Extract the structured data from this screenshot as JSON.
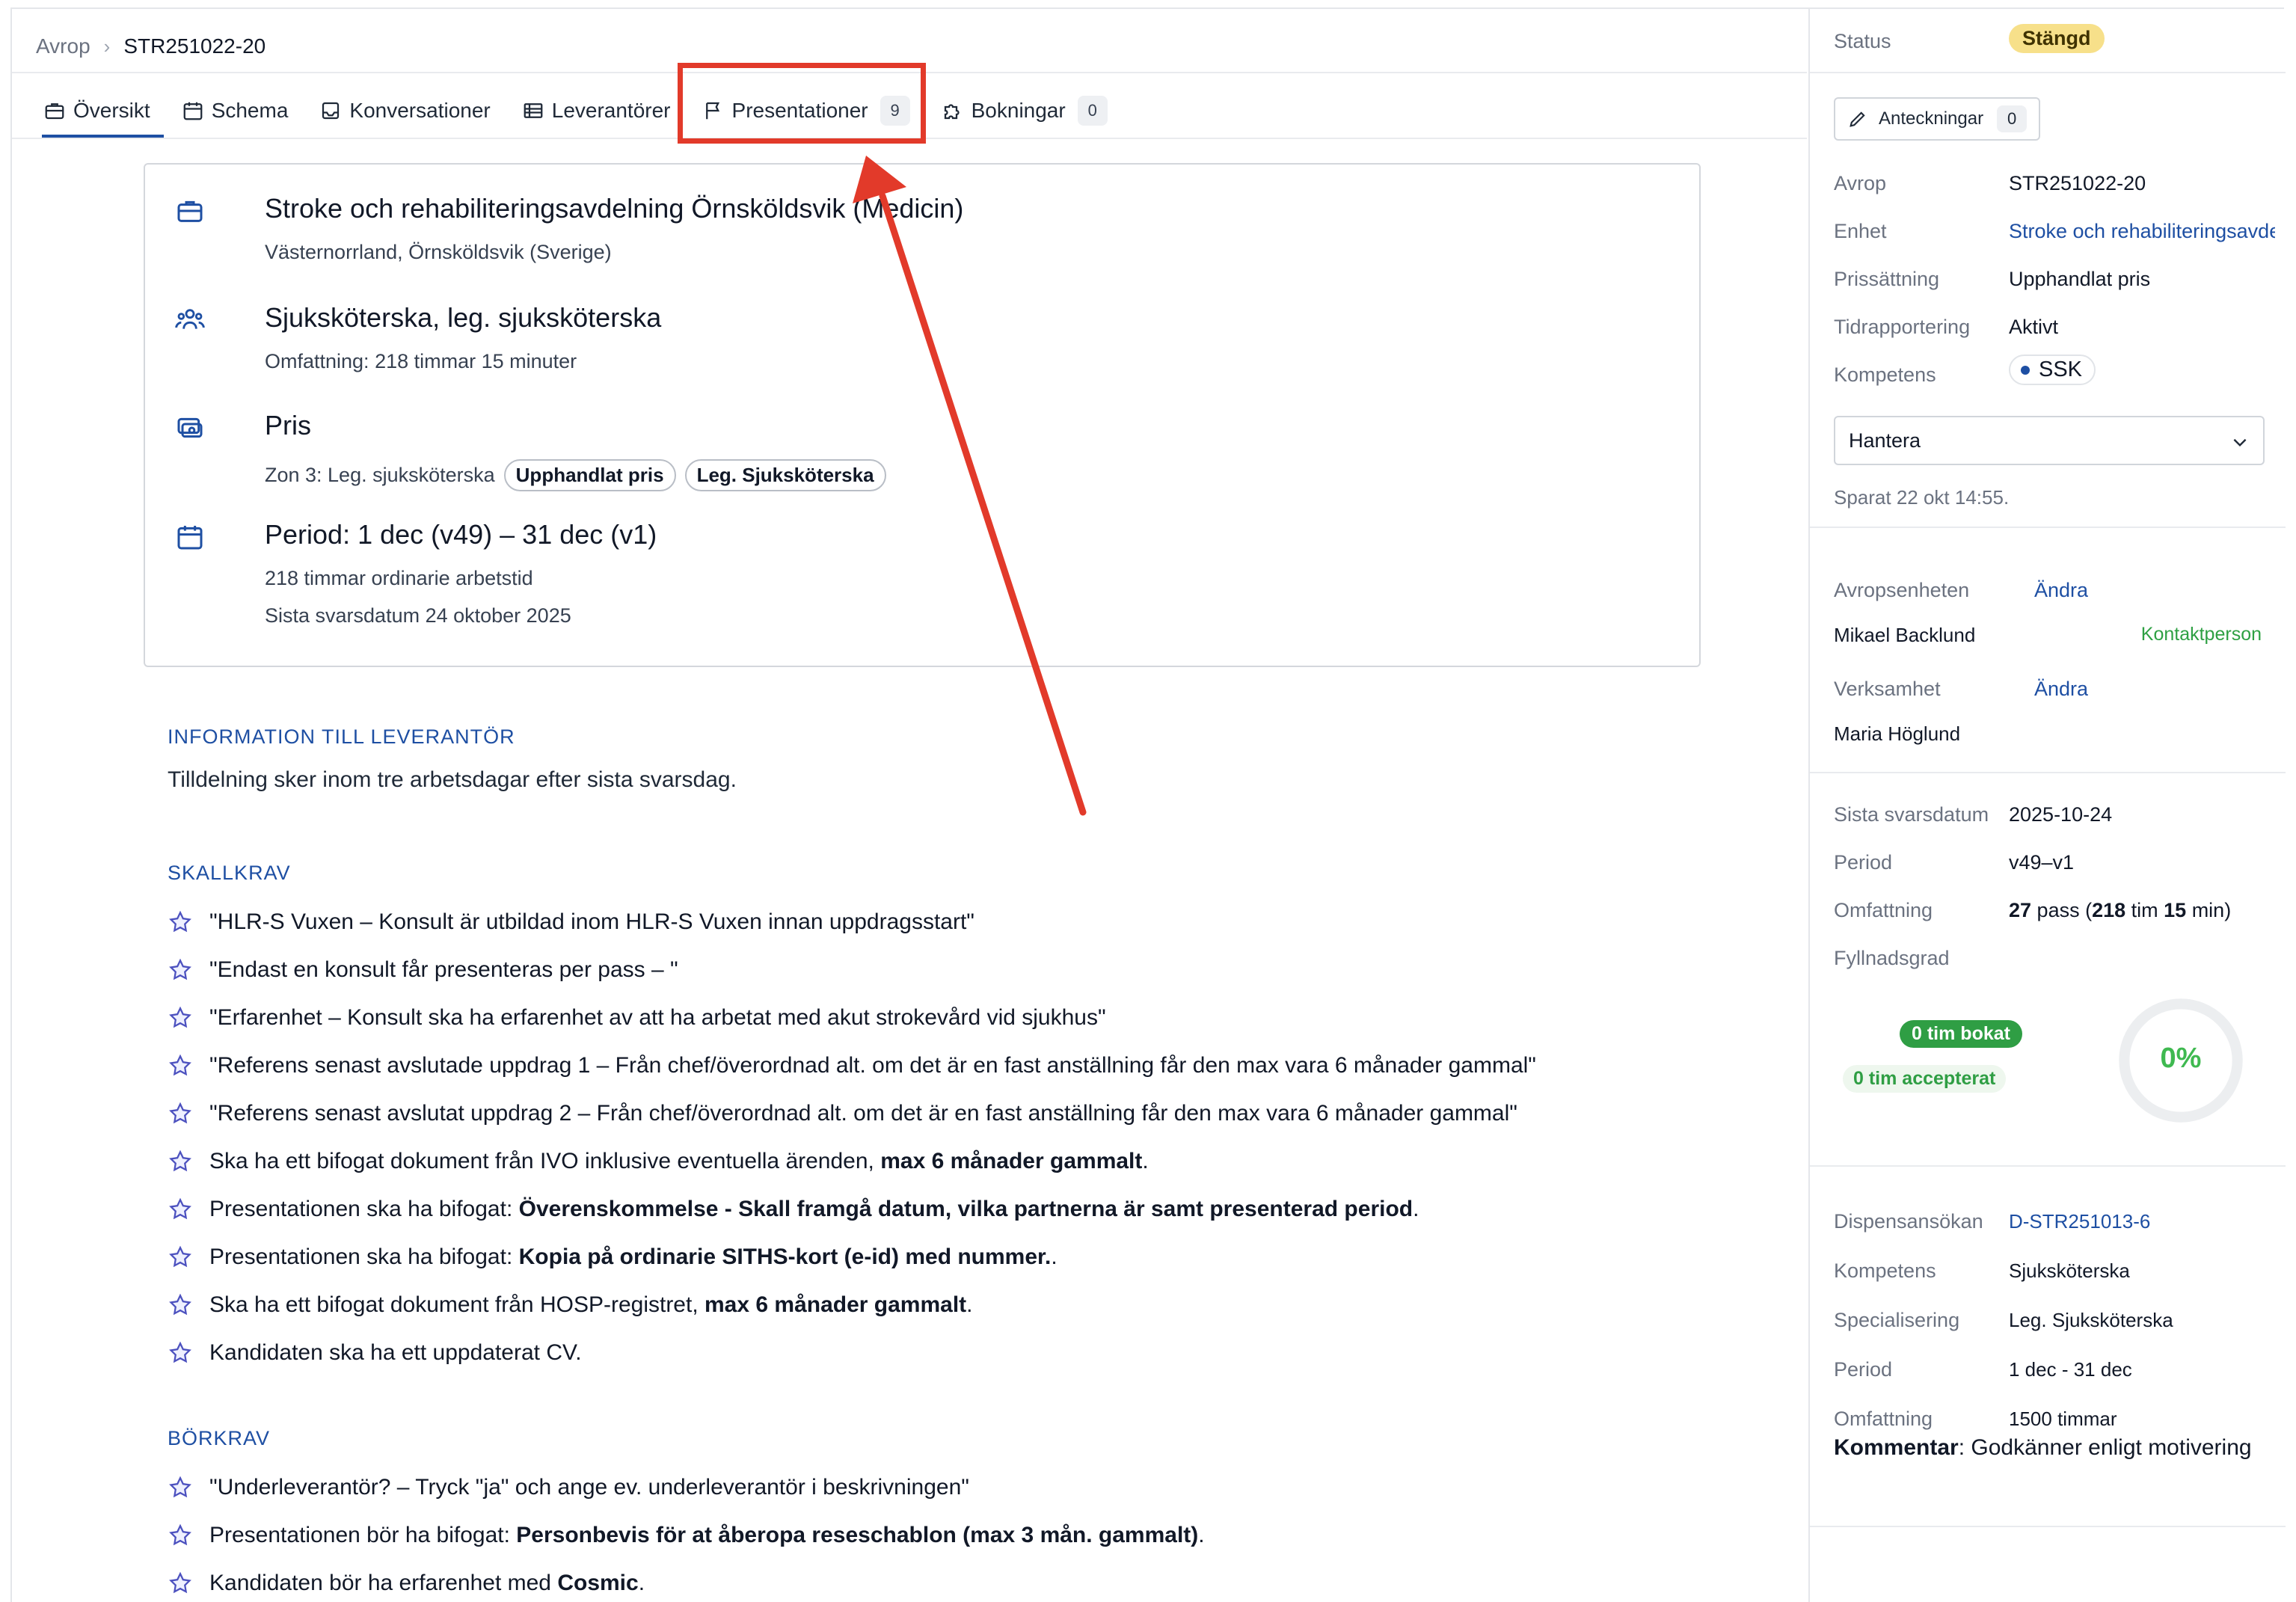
{
  "breadcrumb": {
    "root": "Avrop",
    "current": "STR251022-20"
  },
  "tabs": [
    {
      "label": "Översikt",
      "icon": "briefcase-icon"
    },
    {
      "label": "Schema",
      "icon": "calendar-icon"
    },
    {
      "label": "Konversationer",
      "icon": "inbox-icon"
    },
    {
      "label": "Leverantörer",
      "icon": "list-icon"
    },
    {
      "label": "Presentationer",
      "icon": "flag-icon",
      "badge": "9"
    },
    {
      "label": "Bokningar",
      "icon": "puzzle-icon",
      "badge": "0"
    }
  ],
  "card": {
    "unit_title": "Stroke och rehabiliteringsavdelning Örnsköldsvik (Medicin)",
    "unit_location": "Västernorrland, Örnsköldsvik (Sverige)",
    "role_title": "Sjuksköterska, leg. sjuksköterska",
    "role_scope": "Omfattning: 218 timmar 15 minuter",
    "price_title": "Pris",
    "price_zone": "Zon 3: Leg. sjuksköterska",
    "price_tag1": "Upphandlat pris",
    "price_tag2": "Leg. Sjuksköterska",
    "period_title": "Period: 1 dec (v49) – 31 dec (v1)",
    "period_hours": "218 timmar ordinarie arbetstid",
    "period_deadline": "Sista svarsdatum 24 oktober 2025"
  },
  "info": {
    "heading": "INFORMATION TILL LEVERANTÖR",
    "text": "Tilldelning sker inom tre arbetsdagar efter sista svarsdag."
  },
  "skallkrav": {
    "heading": "SKALLKRAV",
    "items": [
      {
        "text": "\"HLR-S Vuxen – Konsult är utbildad inom HLR-S Vuxen innan uppdragsstart\"",
        "bold": "",
        "tail": ""
      },
      {
        "text": "\"Endast en konsult får presenteras per pass – \"",
        "bold": "",
        "tail": ""
      },
      {
        "text": "\"Erfarenhet – Konsult ska ha erfarenhet av att ha arbetat med akut strokevård vid sjukhus\"",
        "bold": "",
        "tail": ""
      },
      {
        "text": "\"Referens senast avslutade uppdrag 1 – Från chef/överordnad alt. om det är en fast anställning får den max vara 6 månader gammal\"",
        "bold": "",
        "tail": ""
      },
      {
        "text": "\"Referens senast avslutat uppdrag 2 – Från chef/överordnad alt. om det är en fast anställning får den max vara 6 månader gammal\"",
        "bold": "",
        "tail": ""
      },
      {
        "text": "Ska ha ett bifogat dokument från IVO inklusive eventuella ärenden, ",
        "bold": "max 6 månader gammalt",
        "tail": "."
      },
      {
        "text": "Presentationen ska ha bifogat: ",
        "bold": "Överenskommelse - Skall framgå datum, vilka partnerna är samt presenterad period",
        "tail": "."
      },
      {
        "text": "Presentationen ska ha bifogat: ",
        "bold": "Kopia på ordinarie SITHS-kort (e-id) med nummer.",
        "tail": "."
      },
      {
        "text": "Ska ha ett bifogat dokument från HOSP-registret, ",
        "bold": "max 6 månader gammalt",
        "tail": "."
      },
      {
        "text": "Kandidaten ska ha ett uppdaterat CV.",
        "bold": "",
        "tail": ""
      }
    ]
  },
  "borkrav": {
    "heading": "BÖRKRAV",
    "items": [
      {
        "text": "\"Underleverantör? – Tryck \"ja\" och ange ev. underleverantör i beskrivningen\"",
        "bold": "",
        "tail": ""
      },
      {
        "text": "Presentationen bör ha bifogat: ",
        "bold": "Personbevis för at åberopa reseschablon (max 3 mån. gammalt)",
        "tail": "."
      },
      {
        "text": "Kandidaten bör ha erfarenhet med ",
        "bold": "Cosmic",
        "tail": "."
      }
    ]
  },
  "sidebar": {
    "status_label": "Status",
    "status_value": "Stängd",
    "notes_label": "Anteckningar",
    "notes_count": "0",
    "details": [
      {
        "label": "Avrop",
        "value": "STR251022-20",
        "link": false
      },
      {
        "label": "Enhet",
        "value": "Stroke och rehabiliteringsavdelning",
        "link": true
      },
      {
        "label": "Prissättning",
        "value": "Upphandlat pris",
        "link": false
      },
      {
        "label": "Tidrapportering",
        "value": "Aktivt",
        "link": false
      }
    ],
    "competence_label": "Kompetens",
    "competence_chip": "SSK",
    "manage_label": "Hantera",
    "saved_text": "Sparat 22 okt 14:55.",
    "contacts": {
      "unit_label": "Avropsenheten",
      "unit_edit": "Ändra",
      "unit_person": "Mikael Backlund",
      "unit_role": "Kontaktperson",
      "business_label": "Verksamhet",
      "business_edit": "Ändra",
      "business_person": "Maria Höglund"
    },
    "schedule": {
      "deadline_label": "Sista svarsdatum",
      "deadline_value": "2025-10-24",
      "period_label": "Period",
      "period_value": "v49–v1",
      "scope_label": "Omfattning",
      "scope_pass": "27",
      "scope_pass_unit": " pass (",
      "scope_hours": "218",
      "scope_hours_unit": " tim ",
      "scope_min": "15",
      "scope_min_unit": " min)",
      "fill_label": "Fyllnadsgrad",
      "booked": "0 tim bokat",
      "accepted": "0 tim accepterat",
      "fill_percent": "0%"
    },
    "dispensation": [
      {
        "label": "Dispensansökan",
        "value": "D-STR251013-6",
        "link": true
      },
      {
        "label": "Kompetens",
        "value": "Sjuksköterska",
        "link": false
      },
      {
        "label": "Specialisering",
        "value": "Leg. Sjuksköterska",
        "link": false
      },
      {
        "label": "Period",
        "value": "1 dec - 31 dec",
        "link": false
      },
      {
        "label": "Omfattning",
        "value": "1500 timmar",
        "link": false
      }
    ],
    "comment_label": "Kommentar",
    "comment_text": ": Godkänner enligt motivering"
  },
  "colors": {
    "accent": "#1e4fa3",
    "highlight": "#e23a2a",
    "status": "#f7e08a",
    "success": "#2f9e44"
  }
}
